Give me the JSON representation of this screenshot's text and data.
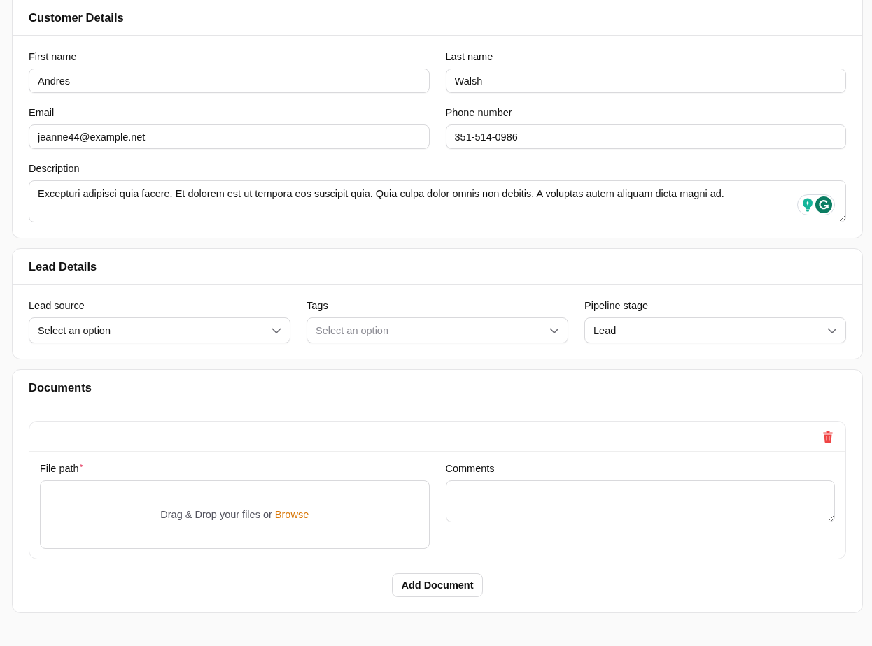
{
  "customer_details": {
    "title": "Customer Details",
    "fields": [
      {
        "label": "First name",
        "value": "Andres"
      },
      {
        "label": "Last name",
        "value": "Walsh"
      },
      {
        "label": "Email",
        "value": "jeanne44@example.net"
      },
      {
        "label": "Phone number",
        "value": "351-514-0986"
      }
    ],
    "description": {
      "label": "Description",
      "value": "Excepturi adipisci quia facere. Et dolorem est ut tempora eos suscipit quia. Quia culpa dolor omnis non debitis. A voluptas autem aliquam dicta magni ad."
    }
  },
  "lead_details": {
    "title": "Lead Details",
    "selects": [
      {
        "label": "Lead source",
        "value": "Select an option"
      },
      {
        "label": "Tags",
        "placeholder": "Select an option"
      },
      {
        "label": "Pipeline stage",
        "value": "Lead"
      }
    ]
  },
  "documents": {
    "title": "Documents",
    "items": [
      {
        "file_path": {
          "label": "File path",
          "required_mark": "*",
          "prompt": "Drag & Drop your files or",
          "link": "Browse"
        },
        "comments": {
          "label": "Comments"
        }
      }
    ],
    "add_button": "Add Document"
  }
}
